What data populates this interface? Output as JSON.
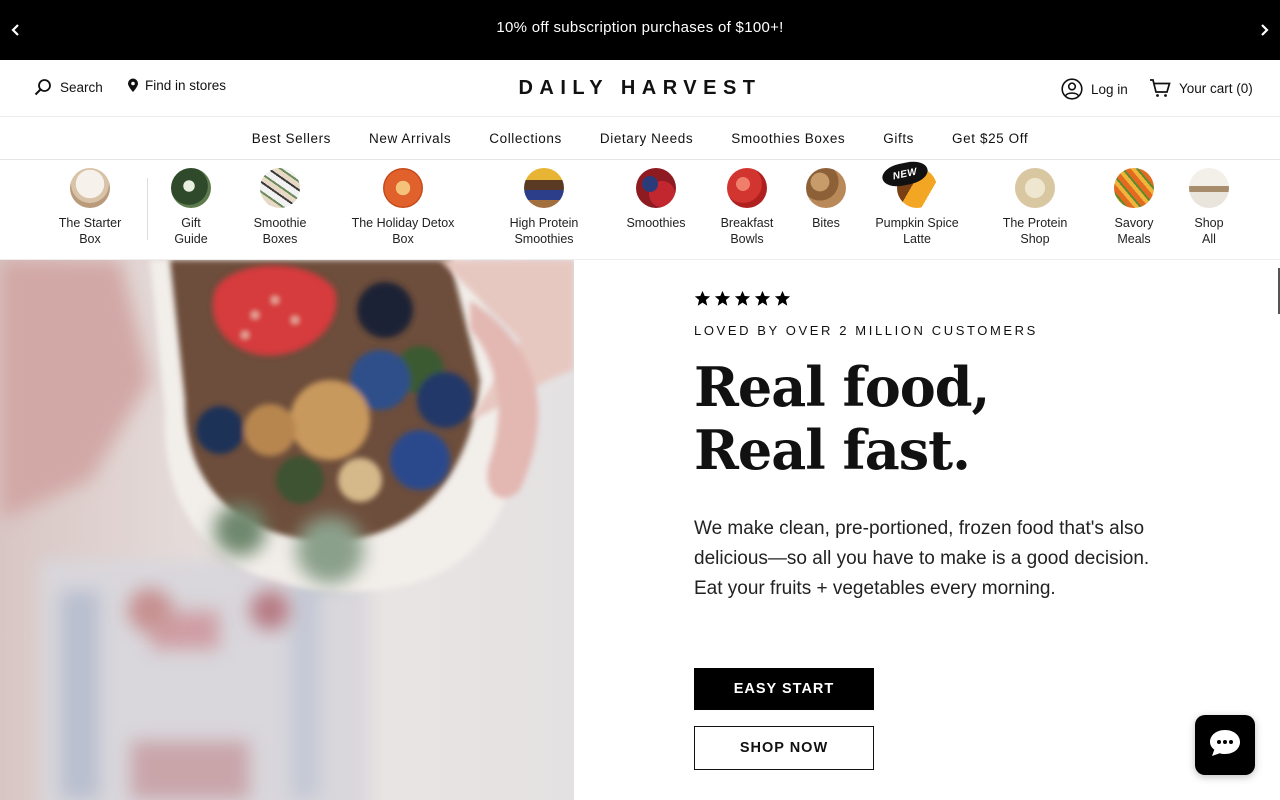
{
  "announcement": {
    "message": "10% off subscription purchases of $100+!",
    "prev_icon": "chevron-left-icon",
    "next_icon": "chevron-right-icon"
  },
  "header": {
    "search_label": "Search",
    "stores_label": "Find in stores",
    "logo_text": "DAILY HARVEST",
    "login_label": "Log in",
    "cart_label": "Your cart (0)"
  },
  "nav": {
    "items": [
      "Best Sellers",
      "New Arrivals",
      "Collections",
      "Dietary Needs",
      "Smoothies Boxes",
      "Gifts",
      "Get $25 Off"
    ]
  },
  "categories": {
    "items": [
      {
        "line1": "The Starter",
        "line2": "Box"
      },
      {
        "line1": "Gift",
        "line2": "Guide"
      },
      {
        "line1": "Smoothie",
        "line2": "Boxes"
      },
      {
        "line1": "The Holiday Detox",
        "line2": "Box"
      },
      {
        "line1": "High Protein",
        "line2": "Smoothies"
      },
      {
        "line1": "Smoothies",
        "line2": ""
      },
      {
        "line1": "Breakfast",
        "line2": "Bowls"
      },
      {
        "line1": "Bites",
        "line2": ""
      },
      {
        "line1": "Pumpkin Spice",
        "line2": "Latte"
      },
      {
        "line1": "The Protein",
        "line2": "Shop"
      },
      {
        "line1": "Savory",
        "line2": "Meals"
      },
      {
        "line1": "Shop",
        "line2": "All"
      }
    ],
    "new_badge": "NEW"
  },
  "hero": {
    "rating_stars": 5,
    "eyebrow": "LOVED BY OVER 2 MILLION CUSTOMERS",
    "headline": "Real food, Real fast.",
    "body": "We make clean, pre-portioned, frozen food that's also delicious—so all you have to make is a good decision. Eat your fruits + vegetables every morning.",
    "primary_button": "EASY START",
    "secondary_button": "SHOP NOW"
  },
  "chat": {
    "icon": "chat-bubble-icon"
  }
}
